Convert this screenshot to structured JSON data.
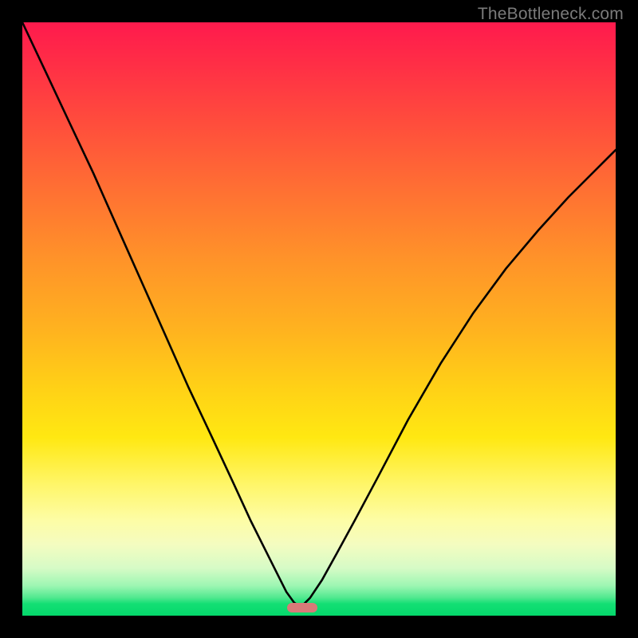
{
  "watermark": "TheBottleneck.com",
  "colors": {
    "frame": "#000000",
    "curve": "#000000",
    "trough": "#d87a78",
    "gradient_top": "#ff1a4d",
    "gradient_bottom": "#05d86b"
  },
  "chart_data": {
    "type": "line",
    "title": "",
    "xlabel": "",
    "ylabel": "",
    "xlim": [
      0,
      1
    ],
    "ylim": [
      0,
      1
    ],
    "grid": false,
    "legend": false,
    "notes": "Axes are unitless/normalized; no tick labels are rendered. y=1 corresponds to the top (red) and y=0 to the bottom (green). Two monotone curves meet at a trough near x≈0.47, y≈0.015. A small rounded marker sits at the trough.",
    "series": [
      {
        "name": "left-branch",
        "x": [
          0.0,
          0.04,
          0.08,
          0.12,
          0.16,
          0.2,
          0.24,
          0.28,
          0.32,
          0.355,
          0.385,
          0.41,
          0.43,
          0.445,
          0.458,
          0.468
        ],
        "y": [
          1.0,
          0.915,
          0.83,
          0.745,
          0.655,
          0.565,
          0.475,
          0.385,
          0.3,
          0.225,
          0.16,
          0.11,
          0.07,
          0.04,
          0.022,
          0.015
        ]
      },
      {
        "name": "right-branch",
        "x": [
          0.47,
          0.485,
          0.505,
          0.53,
          0.56,
          0.6,
          0.65,
          0.705,
          0.76,
          0.815,
          0.87,
          0.92,
          0.965,
          1.0
        ],
        "y": [
          0.015,
          0.03,
          0.06,
          0.105,
          0.16,
          0.235,
          0.33,
          0.425,
          0.51,
          0.585,
          0.65,
          0.705,
          0.75,
          0.785
        ]
      }
    ],
    "trough_marker": {
      "x_center": 0.472,
      "width_frac": 0.051,
      "y": 0.01
    }
  }
}
